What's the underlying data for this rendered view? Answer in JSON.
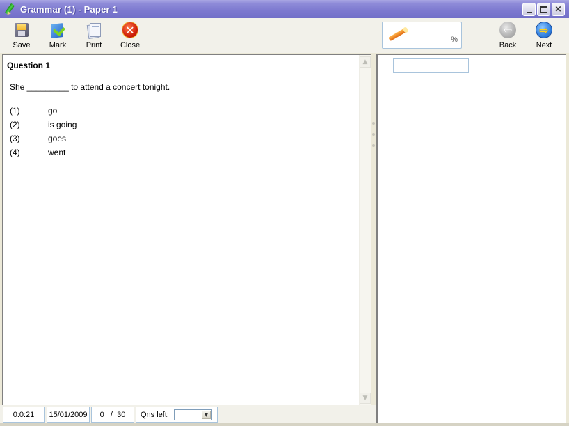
{
  "window": {
    "title": "Grammar (1) - Paper 1",
    "controls": {
      "minimize": "minimize",
      "maximize": "maximize",
      "close": "×"
    }
  },
  "toolbar": {
    "buttons": [
      {
        "label": "Save",
        "icon": "save-disk-icon"
      },
      {
        "label": "Mark",
        "icon": "mark-book-icon"
      },
      {
        "label": "Print",
        "icon": "print-pages-icon"
      },
      {
        "label": "Close",
        "icon": "close-red-x-icon"
      }
    ],
    "score": {
      "value": "",
      "unit": "%"
    },
    "nav": [
      {
        "label": "Back",
        "icon": "back-arrow-icon",
        "enabled": false
      },
      {
        "label": "Next",
        "icon": "next-arrow-icon",
        "enabled": true
      }
    ]
  },
  "question": {
    "title": "Question 1",
    "text": "She _________ to attend a concert tonight.",
    "options": [
      {
        "num": "(1)",
        "text": "go"
      },
      {
        "num": "(2)",
        "text": "is going"
      },
      {
        "num": "(3)",
        "text": "goes"
      },
      {
        "num": "(4)",
        "text": "went"
      }
    ]
  },
  "answer": {
    "value": "",
    "placeholder": ""
  },
  "status": {
    "timer": "0:0:21",
    "date": "15/01/2009",
    "progress": "0   /  30",
    "qns_left_label": "Qns left:",
    "qns_left_value": ""
  }
}
